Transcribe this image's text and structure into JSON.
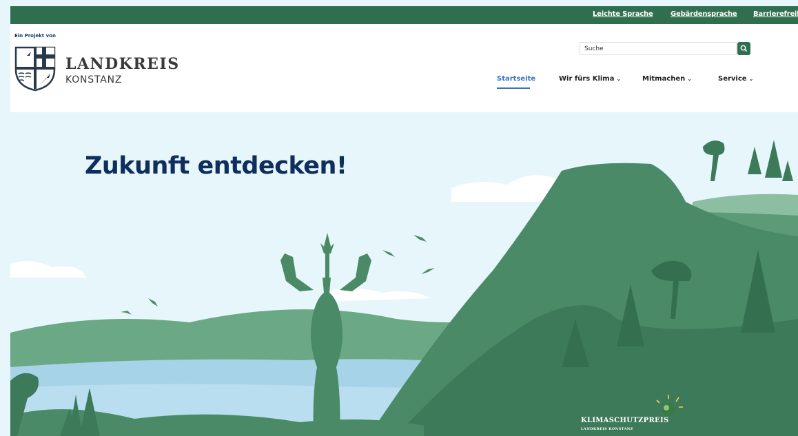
{
  "topbar": {
    "links": [
      "Leichte Sprache",
      "Gebärdensprache",
      "Barrierefreiheit"
    ]
  },
  "header": {
    "project_label": "Ein Projekt von",
    "logo_title": "LANDKREIS",
    "logo_subtitle": "KONSTANZ",
    "search_placeholder": "Suche"
  },
  "nav": {
    "items": [
      {
        "label": "Startseite",
        "active": true,
        "dropdown": false
      },
      {
        "label": "Wir fürs Klima",
        "active": false,
        "dropdown": true
      },
      {
        "label": "Mitmachen",
        "active": false,
        "dropdown": true
      },
      {
        "label": "Service",
        "active": false,
        "dropdown": true
      }
    ]
  },
  "hero": {
    "headline": "Zukunft entdecken!",
    "badge_title": "KLIMASCHUTZPREIS",
    "badge_subtitle": "LANDKREIS KONSTANZ"
  },
  "colors": {
    "topbar": "#2f6f4e",
    "accent_blue": "#3b72c4",
    "headline": "#0f2e5e",
    "sky": "#e6f6fb",
    "green_dark": "#3d7a5a",
    "green_light": "#6aa886",
    "lake": "#a6d3e8"
  },
  "icons": {
    "search": "search-icon",
    "caret": "chevron-down-icon",
    "crest": "landkreis-crest-icon"
  }
}
